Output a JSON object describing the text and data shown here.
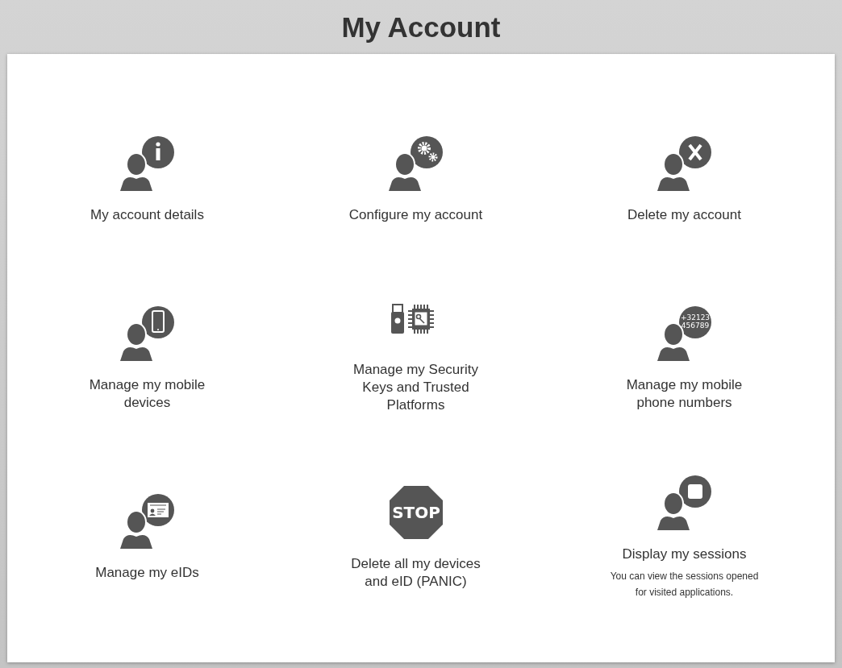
{
  "page": {
    "title": "My Account"
  },
  "tiles": [
    {
      "kind": "info",
      "label": "My account details"
    },
    {
      "kind": "gears",
      "label": "Configure my account"
    },
    {
      "kind": "cross",
      "label": "Delete my account"
    },
    {
      "kind": "phone",
      "label": "Manage my mobile devices"
    },
    {
      "kind": "keys",
      "label": "Manage my Security Keys and Trusted Platforms"
    },
    {
      "kind": "number",
      "icon_text": [
        "+32123",
        "456789"
      ],
      "label": "Manage my mobile phone numbers"
    },
    {
      "kind": "eid",
      "label": "Manage my eIDs"
    },
    {
      "kind": "stop",
      "icon_text": [
        "STOP"
      ],
      "label": "Delete all my devices and eID (PANIC)"
    },
    {
      "kind": "session",
      "label": "Display my sessions",
      "description": "You can view the sessions opened for visited applications."
    }
  ]
}
